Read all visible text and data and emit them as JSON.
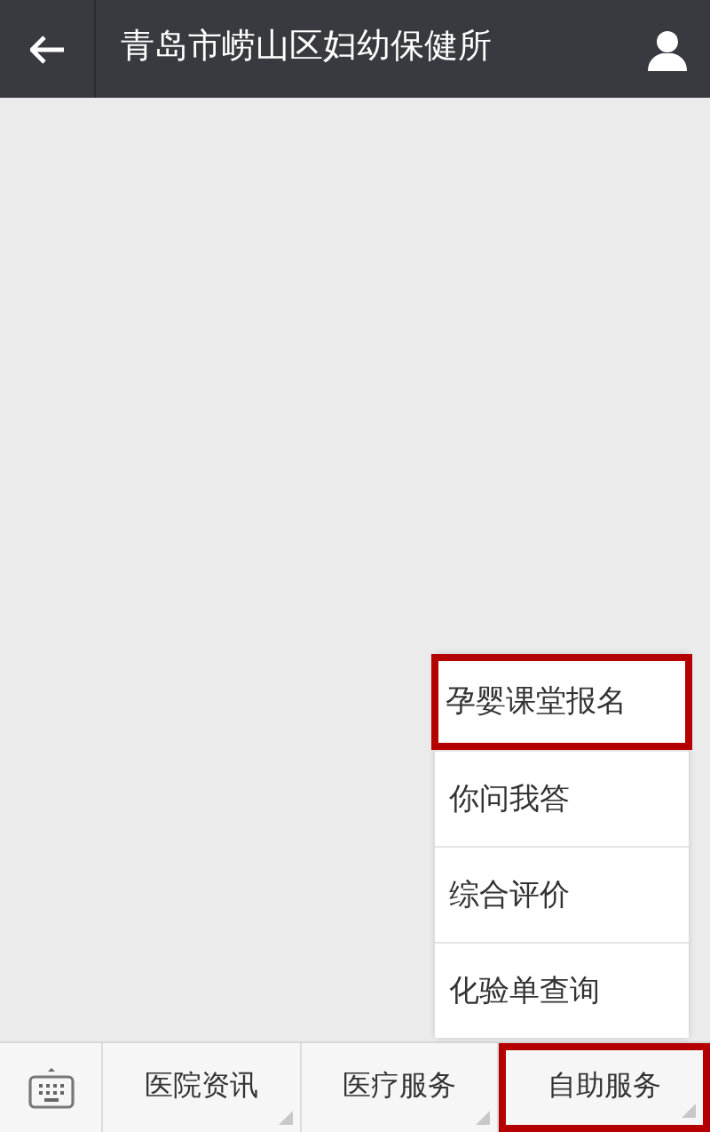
{
  "header": {
    "title": "青岛市崂山区妇幼保健所"
  },
  "popup_menu": [
    {
      "label": "孕婴课堂报名",
      "highlighted": true
    },
    {
      "label": "你问我答",
      "highlighted": false
    },
    {
      "label": "综合评价",
      "highlighted": false
    },
    {
      "label": "化验单查询",
      "highlighted": false
    }
  ],
  "bottom_menu": [
    {
      "label": "医院资讯",
      "highlighted": false
    },
    {
      "label": "医疗服务",
      "highlighted": false
    },
    {
      "label": "自助服务",
      "highlighted": true
    }
  ]
}
